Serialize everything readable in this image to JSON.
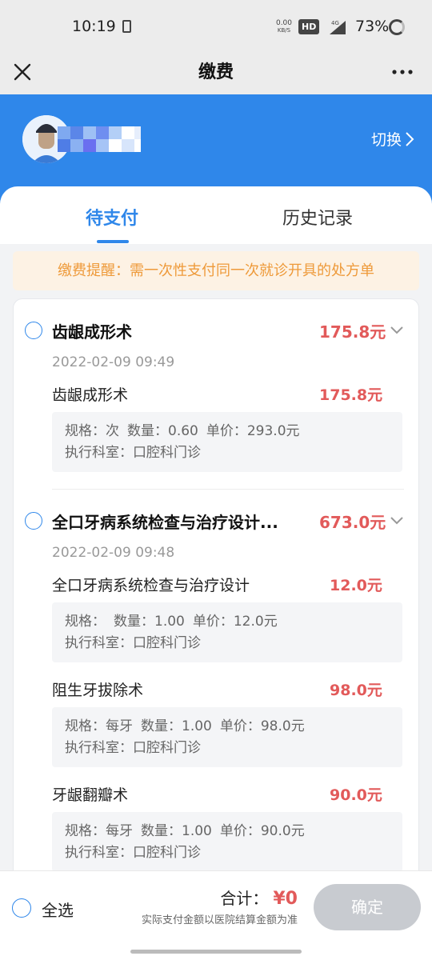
{
  "status_bar": {
    "time": "10:19",
    "net_speed_value": "0.00",
    "net_speed_unit": "KB/S",
    "hd": "HD",
    "network": "4G",
    "battery": "73%"
  },
  "nav": {
    "title": "缴费"
  },
  "header": {
    "switch_label": "切换",
    "colors": {
      "background": "#2f87ea"
    }
  },
  "tabs": [
    {
      "label": "待支付",
      "active": true
    },
    {
      "label": "历史记录",
      "active": false
    }
  ],
  "notice": "缴费提醒：需一次性支付同一次就诊开具的处方单",
  "groups": [
    {
      "title": "齿龈成形术",
      "amount": "175.8元",
      "date": "2022-02-09 09:49",
      "items": [
        {
          "name": "齿龈成形术",
          "amount": "175.8元",
          "spec": "规格：次",
          "qty": "数量：0.60",
          "price": "单价：293.0元",
          "dept": "执行科室：口腔科门诊"
        }
      ]
    },
    {
      "title": "全口牙病系统检查与治疗设计...",
      "amount": "673.0元",
      "date": "2022-02-09 09:48",
      "items": [
        {
          "name": "全口牙病系统检查与治疗设计",
          "amount": "12.0元",
          "spec": "规格：",
          "qty": "数量：1.00",
          "price": "单价：12.0元",
          "dept": "执行科室：口腔科门诊"
        },
        {
          "name": "阻生牙拔除术",
          "amount": "98.0元",
          "spec": "规格：每牙",
          "qty": "数量：1.00",
          "price": "单价：98.0元",
          "dept": "执行科室：口腔科门诊"
        },
        {
          "name": "牙龈翻瓣术",
          "amount": "90.0元",
          "spec": "规格：每牙",
          "qty": "数量：1.00",
          "price": "单价：90.0元",
          "dept": "执行科室：口腔科门诊"
        }
      ]
    }
  ],
  "footer": {
    "select_all": "全选",
    "total_label": "合计：",
    "total_amount": "¥0",
    "total_note": "实际支付金额以医院结算金额为准",
    "confirm": "确定"
  },
  "colors": {
    "accent": "#2f87ea",
    "price": "#e25a5a",
    "notice_text": "#ee9a3a",
    "notice_bg": "#fdf2e4",
    "disabled_button": "#c8cbd0"
  },
  "icons": [
    "close-icon",
    "more-icon",
    "chevron-right-icon",
    "chevron-down-icon",
    "radio-icon"
  ]
}
